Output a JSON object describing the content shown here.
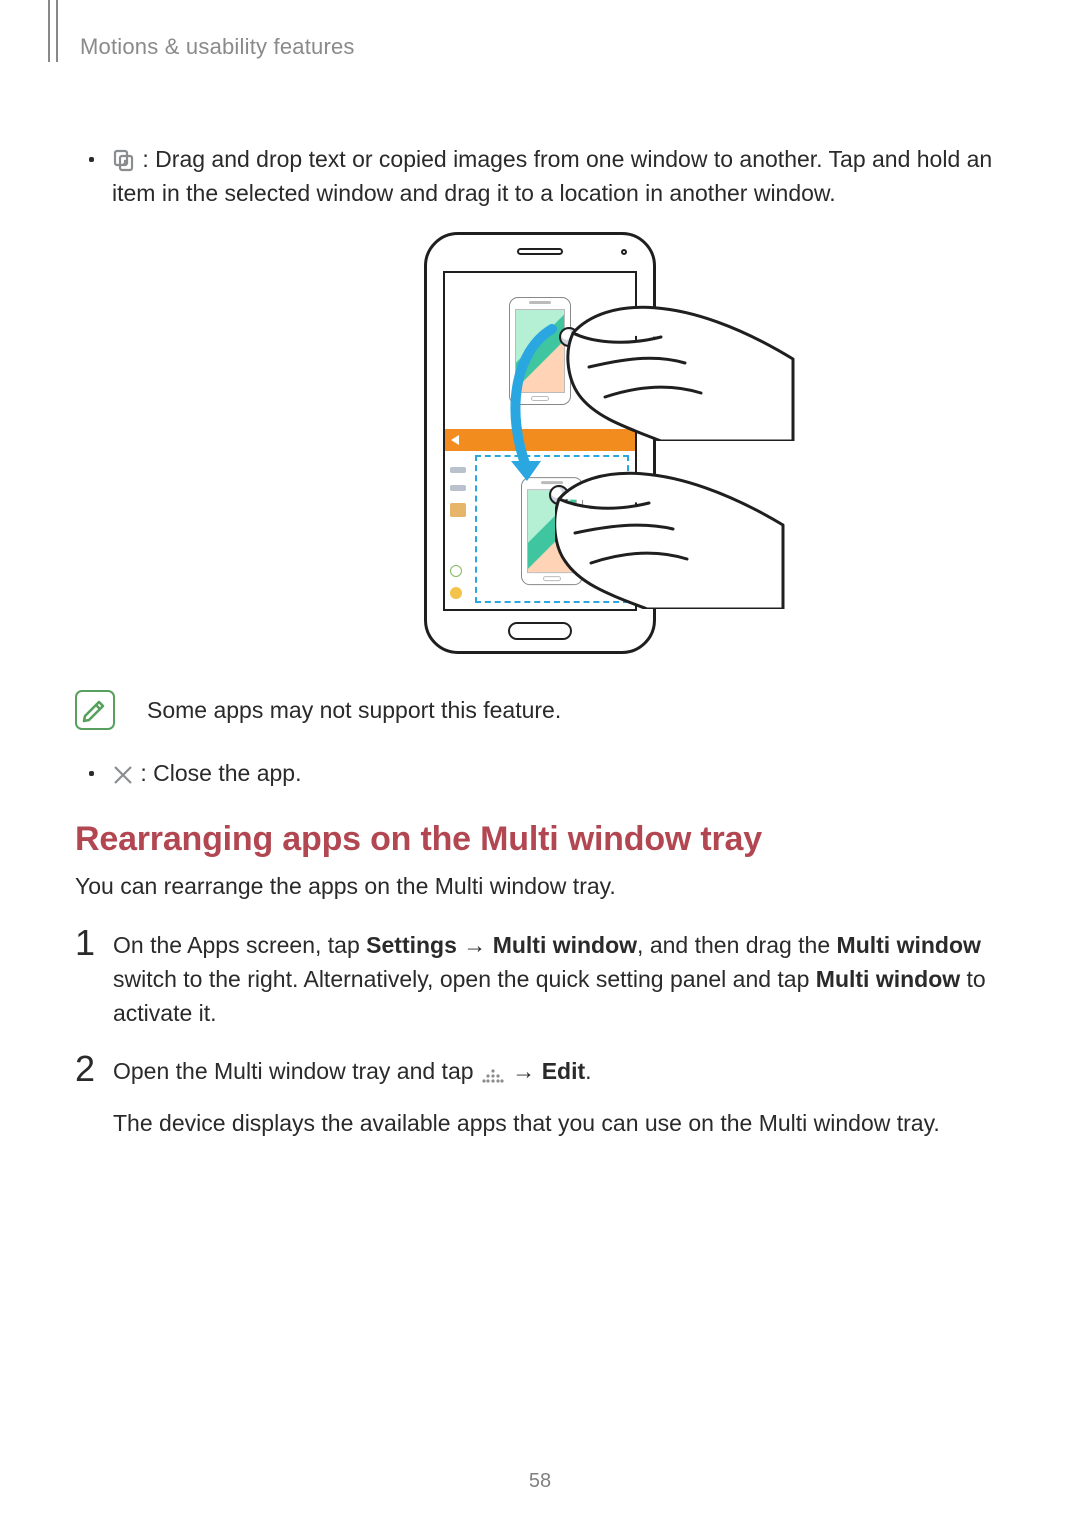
{
  "breadcrumb": "Motions & usability features",
  "bullet_drag": {
    "icon_name": "drag-drop-icon",
    "text": " : Drag and drop text or copied images from one window to another. Tap and hold an item in the selected window and drag it to a location in another window."
  },
  "note": {
    "text": "Some apps may not support this feature."
  },
  "bullet_close": {
    "icon_name": "close-x-icon",
    "text": " : Close the app."
  },
  "section_heading": "Rearranging apps on the Multi window tray",
  "lead": "You can rearrange the apps on the Multi window tray.",
  "steps": [
    {
      "num": "1",
      "pre": "On the Apps screen, tap ",
      "b1": "Settings",
      "arrow1": " → ",
      "b2": "Multi window",
      "mid": ", and then drag the ",
      "b3": "Multi window",
      "post1": " switch to the right. Alternatively, open the quick setting panel and tap ",
      "b4": "Multi window",
      "post2": " to activate it."
    },
    {
      "num": "2",
      "pre": "Open the Multi window tray and tap ",
      "icon_name": "more-dots-icon",
      "arrow": " → ",
      "b1": "Edit",
      "post": ".",
      "after": "The device displays the available apps that you can use on the Multi window tray."
    }
  ],
  "page_number": "58"
}
